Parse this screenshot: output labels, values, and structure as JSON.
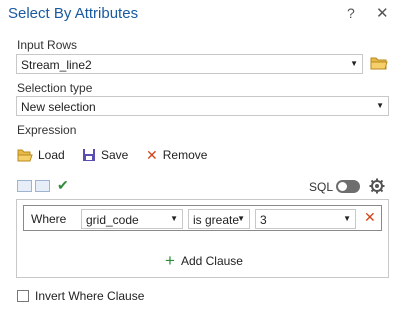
{
  "window": {
    "title": "Select By Attributes",
    "help": "?",
    "close": "✕"
  },
  "input_rows": {
    "label": "Input Rows",
    "value": "Stream_line2"
  },
  "selection_type": {
    "label": "Selection type",
    "value": "New selection"
  },
  "expression": {
    "label": "Expression",
    "load_label": "Load",
    "save_label": "Save",
    "remove_label": "Remove",
    "sql_label": "SQL",
    "sql_toggle_on": false
  },
  "clause": {
    "where_label": "Where",
    "field": "grid_code",
    "operator": "is greate",
    "value": "3",
    "add_label": "Add Clause"
  },
  "invert": {
    "label": "Invert Where Clause",
    "checked": false
  },
  "colors": {
    "title": "#1a5aa0",
    "check": "#2e8b3a",
    "remove": "#d0451b",
    "folder": "#e8b84a"
  }
}
